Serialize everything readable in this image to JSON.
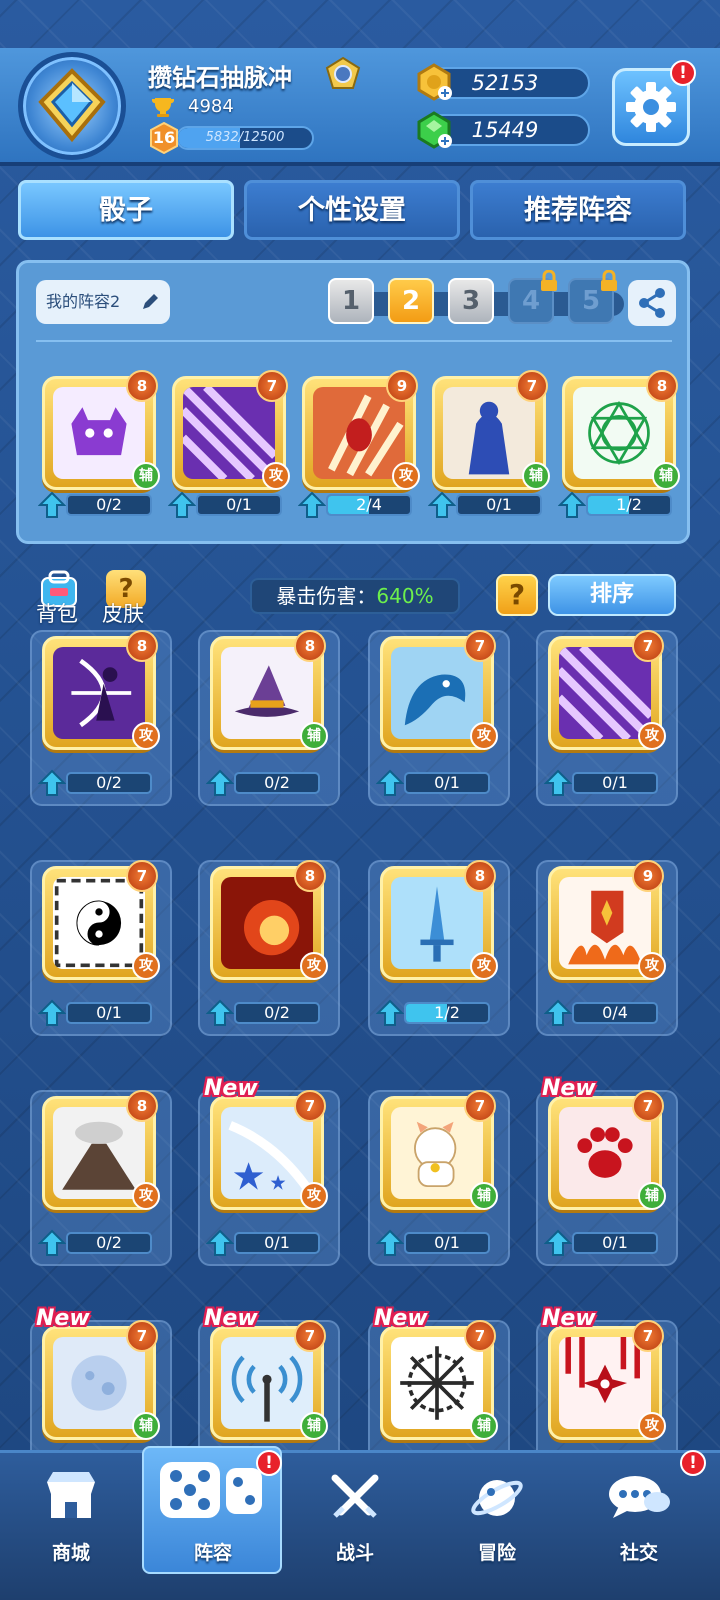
{
  "player": {
    "name": "攒钻石抽脉冲",
    "trophies": "4984",
    "level": "16",
    "xp_text": "5832/12500",
    "xp_fraction": 0.466
  },
  "currency": {
    "gold": "52153",
    "gems": "15449"
  },
  "settings_alert": "!",
  "tabs": [
    {
      "label": "骰子"
    },
    {
      "label": "个性设置"
    },
    {
      "label": "推荐阵容"
    }
  ],
  "deck": {
    "name": "我的阵容2",
    "slots": [
      "1",
      "2",
      "3",
      "4",
      "5"
    ],
    "selected_slot": "2",
    "locked_slots": [
      "4",
      "5"
    ],
    "cards": [
      {
        "icon": "purple-demon-icon",
        "level": "8",
        "role": "辅",
        "progress": "0/2",
        "fill": 0
      },
      {
        "icon": "purple-rays-icon",
        "level": "7",
        "role": "攻",
        "progress": "0/1",
        "fill": 0
      },
      {
        "icon": "fire-claw-icon",
        "level": "9",
        "role": "攻",
        "progress": "2/4",
        "fill": 0.5
      },
      {
        "icon": "blue-body-icon",
        "level": "7",
        "role": "辅",
        "progress": "0/1",
        "fill": 0
      },
      {
        "icon": "green-mandala-icon",
        "level": "8",
        "role": "辅",
        "progress": "1/2",
        "fill": 0.5
      }
    ]
  },
  "side_buttons": {
    "bag": "背包",
    "skin": "皮肤",
    "skin_mark": "?"
  },
  "crit": {
    "label": "暴击伤害：",
    "value": "640%"
  },
  "help_mark": "?",
  "sort_label": "排序",
  "collection": [
    {
      "icon": "archer-icon",
      "level": "8",
      "role": "攻",
      "progress": "0/2",
      "fill": 0,
      "new": ""
    },
    {
      "icon": "witch-hat-icon",
      "level": "8",
      "role": "辅",
      "progress": "0/2",
      "fill": 0,
      "new": ""
    },
    {
      "icon": "water-dragon-icon",
      "level": "7",
      "role": "攻",
      "progress": "0/1",
      "fill": 0,
      "new": ""
    },
    {
      "icon": "purple-rays-icon",
      "level": "7",
      "role": "攻",
      "progress": "0/1",
      "fill": 0,
      "new": ""
    },
    {
      "icon": "yin-yang-icon",
      "level": "7",
      "role": "攻",
      "progress": "0/1",
      "fill": 0,
      "new": ""
    },
    {
      "icon": "fire-burst-icon",
      "level": "8",
      "role": "攻",
      "progress": "0/2",
      "fill": 0,
      "new": ""
    },
    {
      "icon": "ice-sword-icon",
      "level": "8",
      "role": "攻",
      "progress": "1/2",
      "fill": 0.5,
      "new": ""
    },
    {
      "icon": "war-banner-icon",
      "level": "9",
      "role": "攻",
      "progress": "0/4",
      "fill": 0,
      "new": ""
    },
    {
      "icon": "volcano-icon",
      "level": "8",
      "role": "攻",
      "progress": "0/2",
      "fill": 0,
      "new": ""
    },
    {
      "icon": "star-wind-icon",
      "level": "7",
      "role": "攻",
      "progress": "0/1",
      "fill": 0,
      "new": "New"
    },
    {
      "icon": "lucky-cat-icon",
      "level": "7",
      "role": "辅",
      "progress": "0/1",
      "fill": 0,
      "new": ""
    },
    {
      "icon": "paw-print-icon",
      "level": "7",
      "role": "辅",
      "progress": "0/1",
      "fill": 0,
      "new": "New"
    },
    {
      "icon": "moon-icon",
      "level": "7",
      "role": "辅",
      "progress": "",
      "fill": 0,
      "new": "New"
    },
    {
      "icon": "signal-tower-icon",
      "level": "7",
      "role": "辅",
      "progress": "",
      "fill": 0,
      "new": "New"
    },
    {
      "icon": "thorn-web-icon",
      "level": "7",
      "role": "辅",
      "progress": "",
      "fill": 0,
      "new": "New"
    },
    {
      "icon": "shuriken-icon",
      "level": "7",
      "role": "攻",
      "progress": "",
      "fill": 0,
      "new": "New"
    }
  ],
  "nav": {
    "items": [
      {
        "label": "商城"
      },
      {
        "label": "阵容"
      },
      {
        "label": "战斗"
      },
      {
        "label": "冒险"
      },
      {
        "label": "社交"
      }
    ],
    "alert": "!"
  },
  "colors": {
    "attack": "#e0701e",
    "support": "#3fae3a",
    "crit_value": "#6df04c",
    "selected_slot": "#f39c14"
  }
}
